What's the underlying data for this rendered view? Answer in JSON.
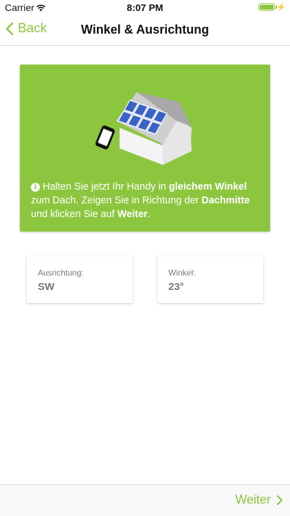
{
  "status_bar": {
    "carrier": "Carrier",
    "time": "8:07 PM",
    "wifi_icon": "wifi-icon",
    "battery_icon": "battery-icon",
    "charging_icon": "bolt-icon"
  },
  "nav": {
    "back_label": "Back",
    "title": "Winkel & Ausrichtung"
  },
  "instruction": {
    "illustration": "house-with-solar-panels-and-phone",
    "info_icon": "info-icon",
    "part1": "Halten Sie jetzt Ihr Handy in ",
    "bold1": "gleichem Winkel",
    "part2": " zum Dach. Zeigen Sie in Richtung der ",
    "bold2": "Dachmitte",
    "part3": " und klicken Sie auf ",
    "bold3": "Weiter",
    "part4": "."
  },
  "orientation": {
    "label": "Ausrichtung:",
    "value": "SW"
  },
  "angle": {
    "label": "Winkel:",
    "value": "23°"
  },
  "footer": {
    "next_label": "Weiter"
  },
  "colors": {
    "accent": "#8cc63f",
    "panel": "#3a63c7"
  }
}
